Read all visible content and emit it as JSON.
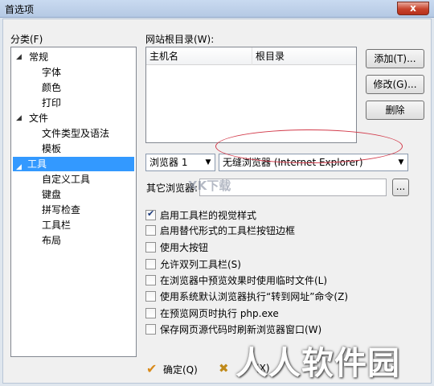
{
  "window": {
    "title": "首选项",
    "close_glyph": "x"
  },
  "category": {
    "label": "分类(F)",
    "tree": [
      {
        "label": "常规",
        "toggle": "◢",
        "children": [
          "字体",
          "颜色",
          "打印"
        ]
      },
      {
        "label": "文件",
        "toggle": "◢",
        "children": [
          "文件类型及语法",
          "模板"
        ]
      },
      {
        "label": "工具",
        "toggle": "◢",
        "selected": true,
        "children": [
          "自定义工具",
          "键盘",
          "拼写检查",
          "工具栏",
          "布局"
        ]
      }
    ]
  },
  "website_root": {
    "label": "网站根目录(W):",
    "columns": [
      "主机名",
      "根目录"
    ],
    "buttons": {
      "add": "添加(T)...",
      "edit": "修改(G)...",
      "delete": "删除"
    }
  },
  "browser": {
    "select_browser": "浏览器 1",
    "select_engine": "无缝浏览器 (Internet Explorer)",
    "other_label": "其它浏览器:",
    "browse_button": "...",
    "highlight_color": "#d23a4a"
  },
  "options": [
    {
      "label": "启用工具栏的视觉样式",
      "checked": true
    },
    {
      "label": "启用替代形式的工具栏按钮边框",
      "checked": false
    },
    {
      "label": "使用大按钮",
      "checked": false
    },
    {
      "label": "允许双列工具栏(S)",
      "checked": false
    },
    {
      "label": "在浏览器中预览效果时使用临时文件(L)",
      "checked": false
    },
    {
      "label": "使用系统默认浏览器执行“转到网址”命令(Z)",
      "checked": false
    },
    {
      "label": "在预览网页时执行 php.exe",
      "checked": false
    },
    {
      "label": "保存网页源代码时刷新浏览器窗口(W)",
      "checked": false
    }
  ],
  "footer": {
    "ok": "确定(Q)",
    "cancel_partial": "(X)",
    "ok_icon": "checkmark-icon",
    "cancel_icon": "cross-icon"
  },
  "watermarks": {
    "center": "XK下载",
    "brand": "人人软件园"
  }
}
